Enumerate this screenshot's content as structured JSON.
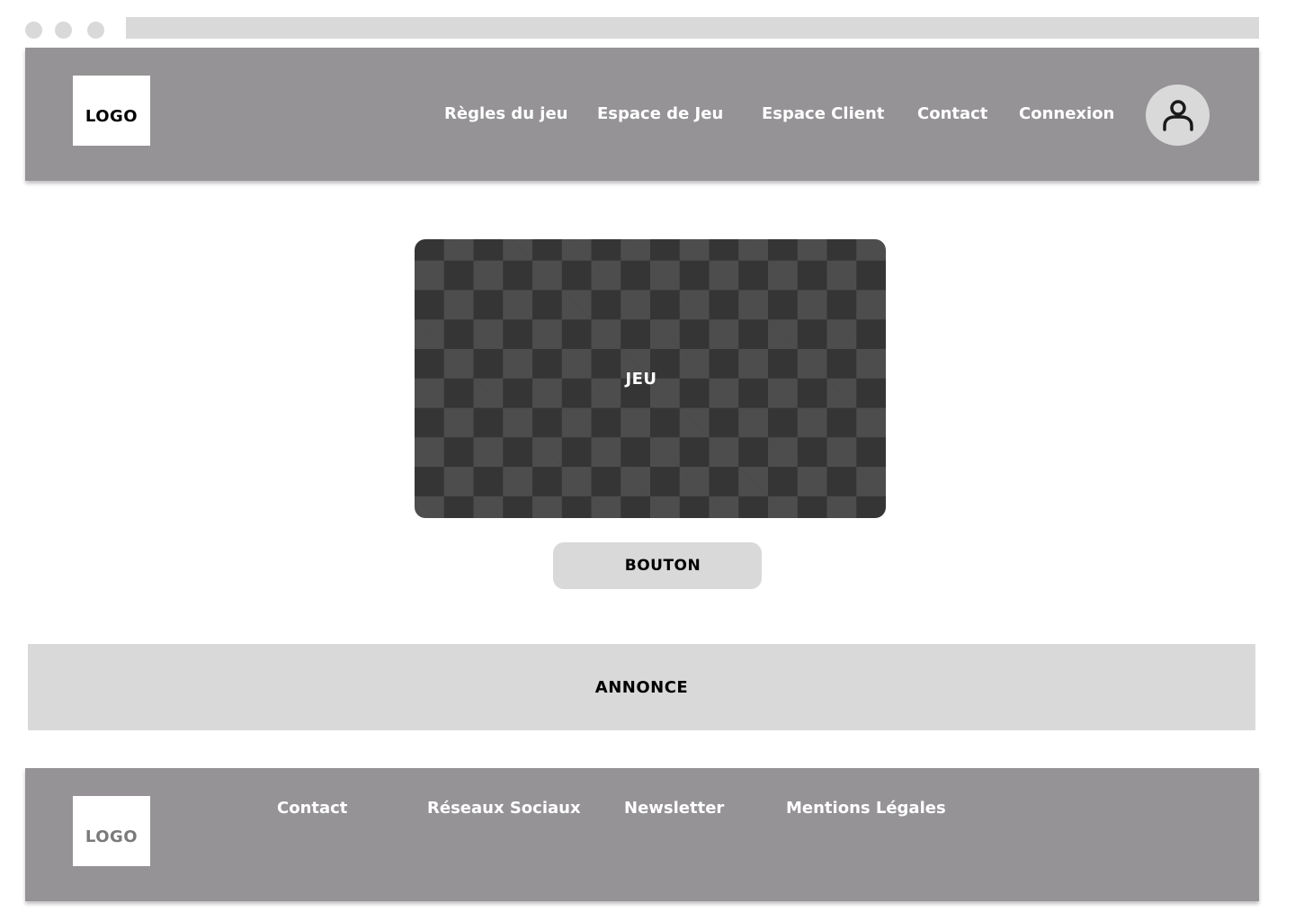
{
  "header": {
    "logo": "LOGO",
    "nav": {
      "rules": "Règles du jeu",
      "game_space": "Espace de Jeu",
      "client_space": "Espace Client",
      "contact": "Contact",
      "login": "Connexion"
    },
    "avatar_icon": "user-icon"
  },
  "main": {
    "game_label": "JEU",
    "button_label": "BOUTON",
    "ad_label": "ANNONCE"
  },
  "footer": {
    "logo": "LOGO",
    "links": {
      "contact": "Contact",
      "social": "Réseaux Sociaux",
      "newsletter": "Newsletter",
      "legal": "Mentions Légales"
    }
  },
  "colors": {
    "bar": "#959396",
    "light_gray": "#d9d9d9",
    "game_dark": "#353535",
    "game_light": "#4d4d4d"
  }
}
